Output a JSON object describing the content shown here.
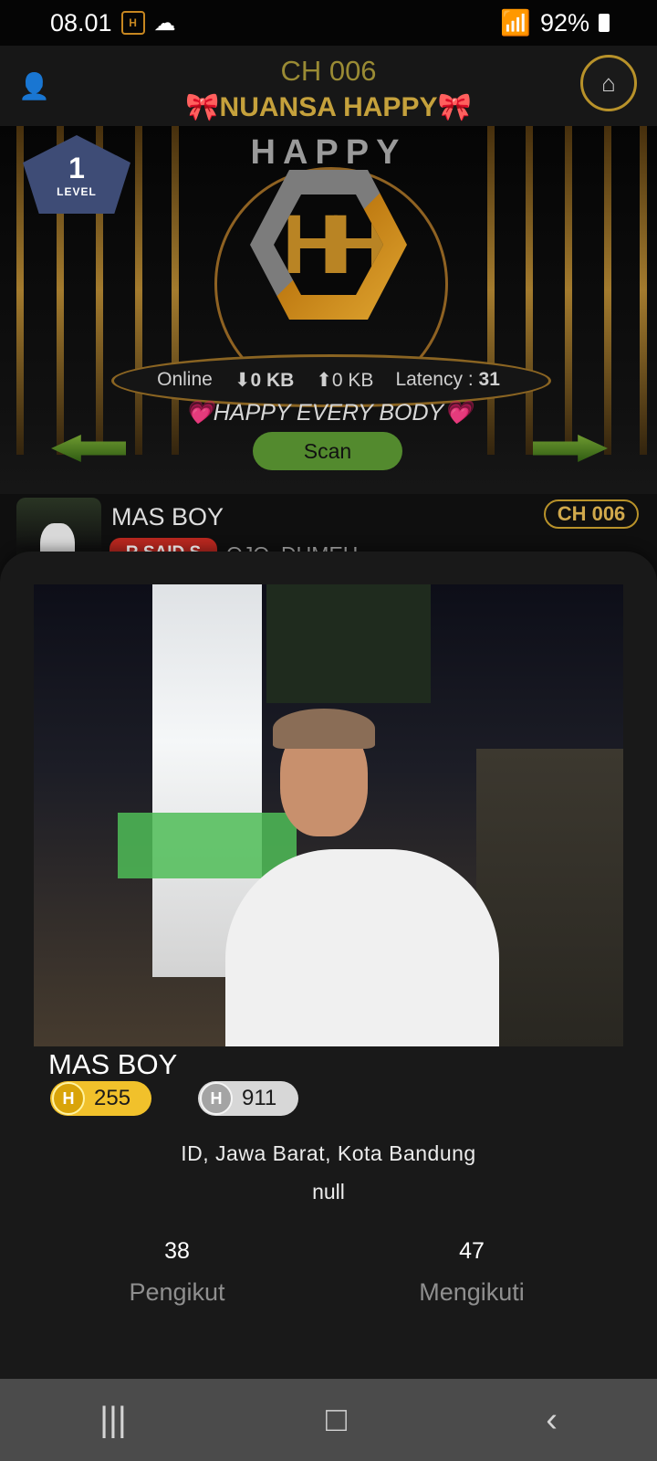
{
  "status": {
    "time": "08.01",
    "battery": "92%"
  },
  "header": {
    "channel_code": "CH 006",
    "channel_name": "🎀NUANSA HAPPY🎀"
  },
  "stage": {
    "brand": "HAPPY",
    "logo_text": "HH",
    "level_number": "1",
    "level_word": "LEVEL",
    "online_label": "Online",
    "download_prefix": "⬇",
    "download_value": "0 KB",
    "upload_prefix": "⬆",
    "upload_value": "0 KB",
    "latency_label": "Latency :",
    "latency_value": "31",
    "motto": "💗HAPPY EVERY BODY💗",
    "scan_label": "Scan"
  },
  "profile_row": {
    "name": "MAS BOY",
    "badge": "CH 006",
    "tag": "R SAID S",
    "extra_text": "OJO.  DUMEH",
    "location_preview": "ID, Jawa Barat, Kota Bandung"
  },
  "profile_sheet": {
    "name": "MAS BOY",
    "gold_amount": "255",
    "silver_amount": "911",
    "coin_letter": "H",
    "location": "ID, Jawa Barat, Kota Bandung",
    "bio": "null",
    "followers_count": "38",
    "followers_label": "Pengikut",
    "following_count": "47",
    "following_label": "Mengikuti"
  },
  "icons": {
    "user": "user-icon",
    "home": "home-icon",
    "verify": "verified-icon",
    "menu": "recent-apps-icon",
    "home_nav": "home-nav-icon",
    "back": "back-icon"
  },
  "colors": {
    "accent_gold": "#b8922a",
    "scan_green": "#538a2e",
    "tag_red": "#b8271f"
  }
}
